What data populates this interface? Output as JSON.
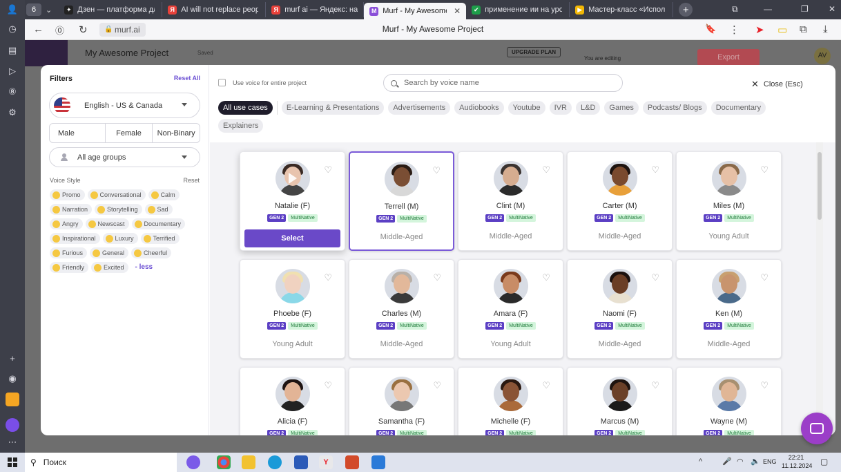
{
  "browser": {
    "tab_count": "6",
    "tabs": [
      {
        "label": "Дзен — платформа для п",
        "fav": "✦",
        "color": "#222"
      },
      {
        "label": "AI will not replace people",
        "fav": "Я",
        "color": "#e8413a"
      },
      {
        "label": "murf ai — Яндекс: нашло",
        "fav": "Я",
        "color": "#e8413a"
      },
      {
        "label": "Murf - My Awesome Pr",
        "fav": "M",
        "color": "#8a4fd8"
      },
      {
        "label": "применение ии на урока",
        "fav": "✔",
        "color": "#1e9e4a"
      },
      {
        "label": "Мастер-класс «Использ",
        "fav": "▶",
        "color": "#f2b705"
      }
    ],
    "url": "murf.ai",
    "page_title": "Murf - My Awesome Project"
  },
  "background_app": {
    "project_title": "My Awesome Project",
    "saved": "Saved",
    "upgrade": "UPGRADE PLAN",
    "editing": "You are editing",
    "export": "Export",
    "user_initials": "AV"
  },
  "filters": {
    "title": "Filters",
    "reset_all": "Reset All",
    "language": "English - US & Canada",
    "gender": [
      "Male",
      "Female",
      "Non-Binary"
    ],
    "age": "All age groups",
    "voice_style_label": "Voice Style",
    "voice_style_reset": "Reset",
    "styles": [
      {
        "label": "Promo",
        "icon": "📢"
      },
      {
        "label": "Conversational",
        "icon": "😀"
      },
      {
        "label": "Calm",
        "icon": "😌"
      },
      {
        "label": "Narration",
        "icon": "📜"
      },
      {
        "label": "Storytelling",
        "icon": "🎬"
      },
      {
        "label": "Sad",
        "icon": "😞"
      },
      {
        "label": "Angry",
        "icon": "😠"
      },
      {
        "label": "Newscast",
        "icon": "📺"
      },
      {
        "label": "Documentary",
        "icon": "🎥"
      },
      {
        "label": "Inspirational",
        "icon": "🙏"
      },
      {
        "label": "Luxury",
        "icon": "💰"
      },
      {
        "label": "Terrified",
        "icon": "😱"
      },
      {
        "label": "Furious",
        "icon": "😡"
      },
      {
        "label": "General",
        "icon": "😐"
      },
      {
        "label": "Cheerful",
        "icon": "😊"
      },
      {
        "label": "Friendly",
        "icon": "🙂"
      },
      {
        "label": "Excited",
        "icon": "🤩"
      }
    ],
    "less": "- less"
  },
  "picker": {
    "use_voice": "Use voice for entire project",
    "search_placeholder": "Search by voice name",
    "close": "Close (Esc)",
    "use_cases": [
      "All use cases",
      "E-Learning & Presentations",
      "Advertisements",
      "Audiobooks",
      "Youtube",
      "IVR",
      "L&D",
      "Games",
      "Podcasts/ Blogs",
      "Documentary",
      "Explainers"
    ],
    "select_label": "Select",
    "gen": "GEN 2",
    "multi": "MultiNative",
    "voices": [
      {
        "name": "Natalie (F)",
        "age": "Middle-Aged",
        "skin": "#e8c4ae",
        "hair": "#3a2a24",
        "cloth": "#444"
      },
      {
        "name": "Terrell (M)",
        "age": "Middle-Aged",
        "skin": "#7a4e34",
        "hair": "#2a1c14",
        "cloth": "#d8d8d8"
      },
      {
        "name": "Clint (M)",
        "age": "Middle-Aged",
        "skin": "#d6ad90",
        "hair": "#3a3330",
        "cloth": "#2b2b2b"
      },
      {
        "name": "Carter (M)",
        "age": "Middle-Aged",
        "skin": "#7a4a2e",
        "hair": "#1e1410",
        "cloth": "#e8a03a"
      },
      {
        "name": "Miles (M)",
        "age": "Young Adult",
        "skin": "#e6c0a6",
        "hair": "#8a6a4a",
        "cloth": "#8a8a8a"
      },
      {
        "name": "Phoebe (F)",
        "age": "Young Adult",
        "skin": "#f0d2c0",
        "hair": "#f0e0b0",
        "cloth": "#8ad8e8"
      },
      {
        "name": "Charles (M)",
        "age": "Middle-Aged",
        "skin": "#e2b89a",
        "hair": "#b8b0a8",
        "cloth": "#3a3a3a"
      },
      {
        "name": "Amara (F)",
        "age": "Young Adult",
        "skin": "#c88c66",
        "hair": "#7a3a1c",
        "cloth": "#2a2a2a"
      },
      {
        "name": "Naomi (F)",
        "age": "Middle-Aged",
        "skin": "#6a3e26",
        "hair": "#1c1210",
        "cloth": "#e8e0d0"
      },
      {
        "name": "Ken (M)",
        "age": "Middle-Aged",
        "skin": "#c8946e",
        "hair": "#c8a070",
        "cloth": "#4a6a8a"
      },
      {
        "name": "Alicia (F)",
        "age": "",
        "skin": "#e2b496",
        "hair": "#1e1412",
        "cloth": "#222"
      },
      {
        "name": "Samantha (F)",
        "age": "",
        "skin": "#ecc8b0",
        "hair": "#9a7040",
        "cloth": "#777"
      },
      {
        "name": "Michelle (F)",
        "age": "",
        "skin": "#8a5436",
        "hair": "#2a1810",
        "cloth": "#aa6a3a"
      },
      {
        "name": "Marcus (M)",
        "age": "",
        "skin": "#6a4028",
        "hair": "#1e1410",
        "cloth": "#1a1a1a"
      },
      {
        "name": "Wayne (M)",
        "age": "",
        "skin": "#e0b696",
        "hair": "#a89070",
        "cloth": "#5a7aa8"
      }
    ]
  },
  "taskbar": {
    "search": "Поиск",
    "lang": "ENG",
    "time": "22:21",
    "date": "11.12.2024"
  },
  "colors": {
    "accent": "#6a49c8",
    "dark_chip": "#1f1d2b"
  }
}
